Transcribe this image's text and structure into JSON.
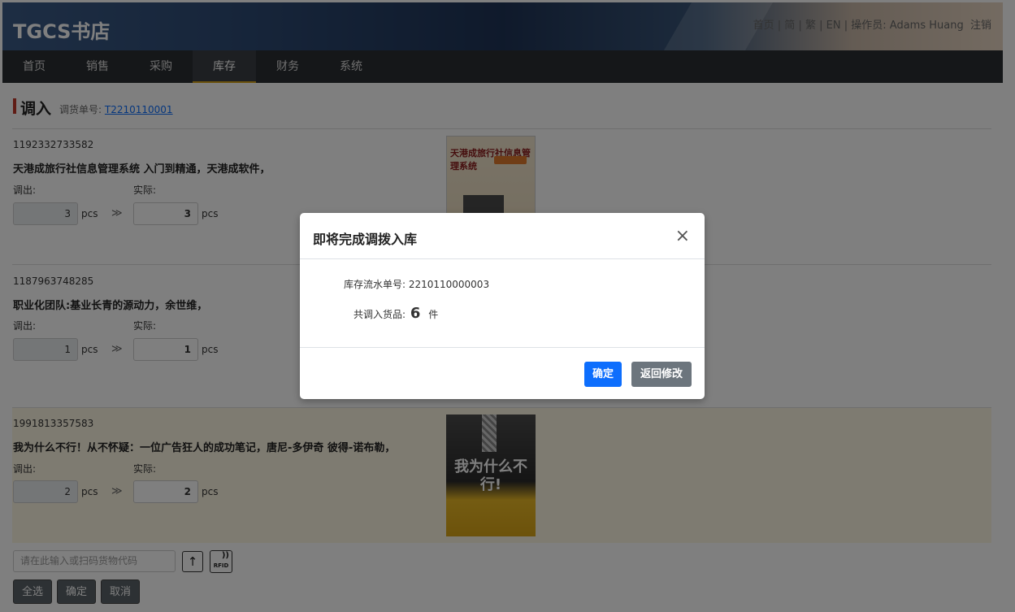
{
  "header": {
    "brand": "TGCS书店",
    "links": [
      "首页",
      "简",
      "繁",
      "EN"
    ],
    "operator_label": "操作员:",
    "operator_name": "Adams Huang",
    "logout": "注销"
  },
  "nav": {
    "items": [
      "首页",
      "销售",
      "采购",
      "库存",
      "财务",
      "系统"
    ],
    "active": "库存"
  },
  "page": {
    "title": "调入",
    "doc_label": "调货单号:",
    "doc_number": "T2210110001",
    "out_label": "调出:",
    "actual_label": "实际:",
    "unit": "pcs",
    "arrow": "≫"
  },
  "items": [
    {
      "code": "1192332733582",
      "name": "天港成旅行社信息管理系统 入门到精通，天港成软件，",
      "out_qty": "3",
      "actual_qty": "3",
      "cover_title": "天港成旅行社信息管理系统"
    },
    {
      "code": "1187963748285",
      "name": "职业化团队:基业长青的源动力，余世维，",
      "out_qty": "1",
      "actual_qty": "1"
    },
    {
      "code": "1991813357583",
      "name": "我为什么不行！从不怀疑：一位广告狂人的成功笔记，唐尼-多伊奇 彼得-诺布勒，",
      "out_qty": "2",
      "actual_qty": "2",
      "cover_title": "我为什么不行!"
    }
  ],
  "scan": {
    "placeholder": "请在此输入或扫码货物代码",
    "rfid_label": "RFID"
  },
  "buttons": {
    "select_all": "全选",
    "confirm": "确定",
    "cancel": "取消"
  },
  "modal": {
    "title": "即将完成调拨入库",
    "close": "×",
    "flow_label": "库存流水单号:",
    "flow_number": "2210110000003",
    "count_label": "共调入货品:",
    "count": "6",
    "count_unit": "件",
    "ok": "确定",
    "back": "返回修改"
  }
}
